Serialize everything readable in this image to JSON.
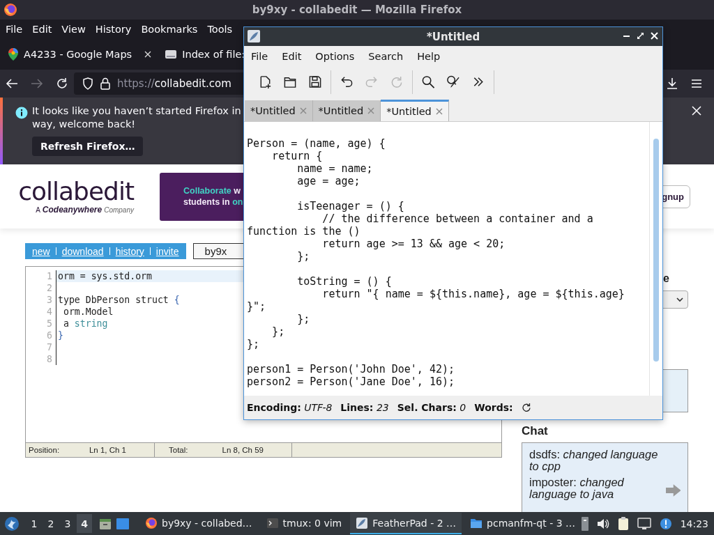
{
  "firefox": {
    "title": "by9xy - collabedit — Mozilla Firefox",
    "menu": [
      "File",
      "Edit",
      "View",
      "History",
      "Bookmarks",
      "Tools"
    ],
    "tabs": [
      {
        "label": "A4233 - Google Maps",
        "selected": false
      },
      {
        "label": "Index of file:",
        "selected": false
      }
    ],
    "url": {
      "scheme": "https://",
      "host": "collabedit.com"
    },
    "notification": {
      "lines": [
        "It looks like you haven’t started Firefox in",
        "way, welcome back!"
      ],
      "button": "Refresh Firefox…"
    }
  },
  "collabedit": {
    "logo": "collabedit",
    "tagline": [
      "A",
      "Codeanywhere",
      "Company"
    ],
    "banner": [
      [
        {
          "text": "Collaborate",
          "accent": true
        },
        {
          "text": "w",
          "accent": false
        }
      ],
      [
        {
          "text": "students in",
          "accent": false
        },
        {
          "text": "on",
          "accent": true
        }
      ]
    ],
    "signup": "gnup",
    "nav": [
      "new",
      "download",
      "history",
      "invite"
    ],
    "document": "by9x",
    "editor": {
      "lines": [
        {
          "number": "1",
          "current": true,
          "tokens": [
            {
              "text": "orm = sys.std.orm",
              "kind": "plain"
            }
          ]
        },
        {
          "number": "2",
          "current": false
        },
        {
          "number": "3",
          "current": false,
          "tokens": [
            {
              "text": "type DbPerson struct ",
              "kind": "plain"
            },
            {
              "text": "{",
              "kind": "brace"
            }
          ]
        },
        {
          "number": "4",
          "current": false,
          "tokens": [
            {
              "text": " orm.Model",
              "kind": "plain"
            }
          ]
        },
        {
          "number": "5",
          "current": false,
          "tokens": [
            {
              "text": " a ",
              "kind": "plain"
            },
            {
              "text": "string",
              "kind": "type"
            }
          ]
        },
        {
          "number": "6",
          "current": false,
          "tokens": [
            {
              "text": "}",
              "kind": "brace"
            }
          ]
        },
        {
          "number": "7",
          "current": false
        },
        {
          "number": "8",
          "current": false
        }
      ]
    },
    "status": {
      "position_label": "Position:",
      "position": "Ln 1, Ch 1",
      "total_label": "Total:",
      "total": "Ln 8, Ch 59"
    },
    "side_heading": "e",
    "chat": {
      "title": "Chat",
      "messages": [
        "dsdfs: *changed language to cpp*",
        "imposter: *changed language to java*"
      ]
    }
  },
  "featherpad": {
    "title": "*Untitled",
    "menu": [
      "File",
      "Edit",
      "Options",
      "Search",
      "Help"
    ],
    "toolbar": [
      {
        "kind": "new",
        "disabled": false
      },
      {
        "kind": "open",
        "disabled": false
      },
      {
        "kind": "save",
        "disabled": false
      },
      {
        "kind": "undo",
        "disabled": false
      },
      {
        "kind": "redo",
        "disabled": true
      },
      {
        "kind": "reload",
        "disabled": true
      },
      {
        "kind": "find",
        "disabled": false
      },
      {
        "kind": "replace",
        "disabled": false
      },
      {
        "kind": "more",
        "disabled": false
      }
    ],
    "tabs": [
      {
        "label": "*Untitled",
        "selected": false
      },
      {
        "label": "*Untitled",
        "selected": false
      },
      {
        "label": "*Untitled",
        "selected": true
      }
    ],
    "code": "Person = (name, age) {\n    return {\n        name = name;\n        age = age;\n\n        isTeenager = () {\n            // the difference between a container and a\nfunction is the ()\n            return age >= 13 && age < 20;\n        };\n\n        toString = () {\n            return \"{ name = ${this.name}, age = ${this.age}\n}\";\n        };\n    };\n};\n\nperson1 = Person('John Doe', 42);\nperson2 = Person('Jane Doe', 16);",
    "status": [
      {
        "label": "Encoding:",
        "value": "UTF-8"
      },
      {
        "label": "Lines:",
        "value": "23"
      },
      {
        "label": "Sel. Chars:",
        "value": "0"
      },
      {
        "label": "Words:"
      }
    ]
  },
  "taskbar": {
    "workspaces": [
      {
        "label": "1",
        "selected": false
      },
      {
        "label": "2",
        "selected": false
      },
      {
        "label": "3",
        "selected": false
      },
      {
        "label": "4",
        "selected": true
      }
    ],
    "tasks": [
      {
        "kind": "browser",
        "label": "by9xy - collabed…",
        "selected": false
      },
      {
        "kind": "terminal",
        "label": "tmux: 0 vim",
        "selected": false
      },
      {
        "kind": "editor",
        "label": "FeatherPad - 2 …",
        "selected": true
      },
      {
        "kind": "folder",
        "label": "pcmanfm-qt - 3 …",
        "selected": false
      }
    ],
    "clock": "14:23"
  }
}
